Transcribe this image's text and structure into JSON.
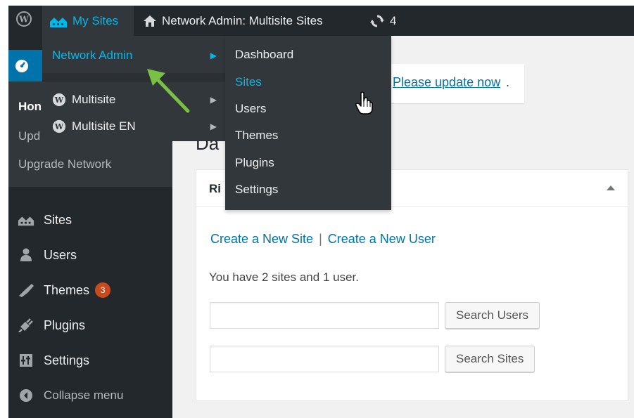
{
  "adminbar": {
    "wp_logo_icon": "wordpress-logo-icon",
    "my_sites": "My Sites",
    "network_admin_title": "Network Admin: Multisite Sites",
    "updates_count": "4"
  },
  "dropdown_primary": {
    "network_admin": "Network Admin",
    "sites": [
      "Multisite",
      "Multisite EN"
    ]
  },
  "dropdown_network": {
    "items": [
      "Dashboard",
      "Sites",
      "Users",
      "Themes",
      "Plugins",
      "Settings"
    ],
    "active": "Sites"
  },
  "sidebar": {
    "submenu": {
      "home": "Hon",
      "updates": "Upd",
      "upgrade": "Upgrade Network"
    },
    "nav": [
      {
        "label": "Sites",
        "icon": "sites-icon"
      },
      {
        "label": "Users",
        "icon": "users-icon"
      },
      {
        "label": "Themes",
        "icon": "themes-icon",
        "badge": "3"
      },
      {
        "label": "Plugins",
        "icon": "plugins-icon"
      },
      {
        "label": "Settings",
        "icon": "settings-icon"
      }
    ],
    "collapse": "Collapse menu"
  },
  "main": {
    "notice_tail": "!",
    "notice_link": "Please update now",
    "notice_end": ".",
    "page_title_partial": "Da",
    "box": {
      "title_partial": "Ri",
      "create_site": "Create a New Site",
      "separator": "|",
      "create_user": "Create a New User",
      "summary": "You have 2 sites and 1 user.",
      "search_users_value": "",
      "search_users_button": "Search Users",
      "search_sites_value": "",
      "search_sites_button": "Search Sites"
    }
  },
  "colors": {
    "adminbar_bg": "#23282d",
    "highlight": "#00b9eb",
    "menu_active": "#0073aa",
    "badge": "#ca4a1f",
    "annotation_arrow": "#7ac143"
  }
}
